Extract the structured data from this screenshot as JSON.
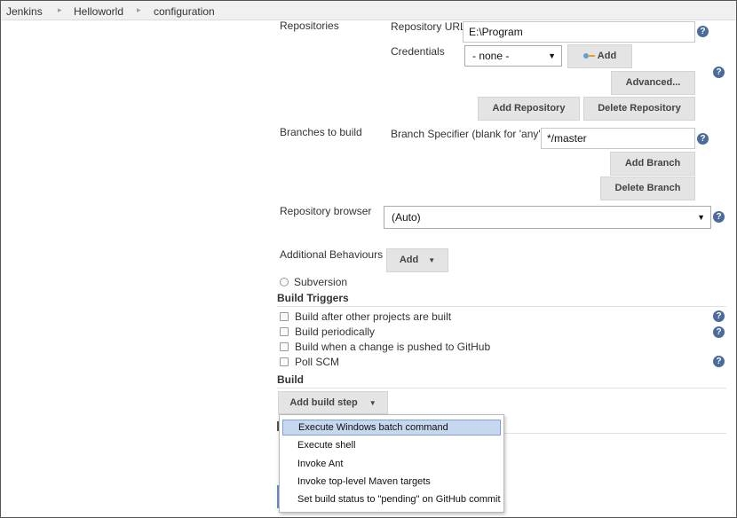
{
  "breadcrumb": {
    "items": [
      "Jenkins",
      "Helloworld",
      "configuration"
    ],
    "separator": "▸"
  },
  "scm": {
    "repositories_label": "Repositories",
    "repository_url_label": "Repository URL",
    "repository_url_value": "E:\\Program",
    "credentials_label": "Credentials",
    "credentials_selected": "- none -",
    "add_credentials_label": "Add",
    "advanced_label": "Advanced...",
    "add_repository_label": "Add Repository",
    "delete_repository_label": "Delete Repository",
    "branches_label": "Branches to build",
    "branch_specifier_label": "Branch Specifier (blank for 'any')",
    "branch_specifier_value": "*/master",
    "add_branch_label": "Add Branch",
    "delete_branch_label": "Delete Branch",
    "repo_browser_label": "Repository browser",
    "repo_browser_selected": "(Auto)",
    "additional_behaviours_label": "Additional Behaviours",
    "additional_behaviours_add_label": "Add",
    "subversion_label": "Subversion"
  },
  "build_triggers": {
    "title": "Build Triggers",
    "items": [
      "Build after other projects are built",
      "Build periodically",
      "Build when a change is pushed to GitHub",
      "Poll SCM"
    ]
  },
  "build": {
    "title": "Build",
    "add_step_label": "Add build step",
    "menu_items": [
      "Execute Windows batch command",
      "Execute shell",
      "Invoke Ant",
      "Invoke top-level Maven targets",
      "Set build status to \"pending\" on GitHub commit"
    ]
  },
  "icons": {
    "help": "?",
    "caret": "▼",
    "help_color": "#4a6b9b"
  }
}
